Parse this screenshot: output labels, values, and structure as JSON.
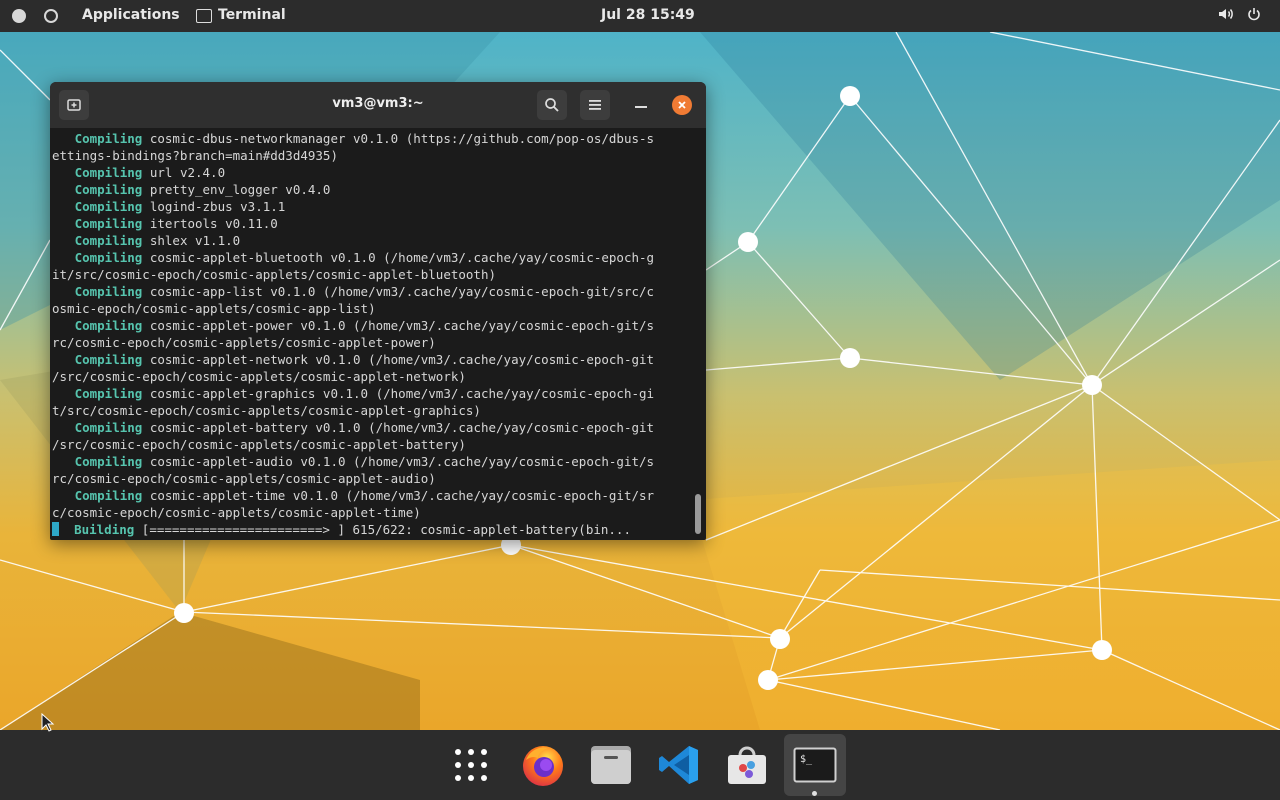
{
  "top_panel": {
    "applications_label": "Applications",
    "terminal_label": "Terminal",
    "datetime": "Jul 28  15:49",
    "volume_icon": "volume-icon",
    "power_icon": "power-icon"
  },
  "terminal": {
    "title": "vm3@vm3:~",
    "lines": [
      {
        "kw": "   Compiling",
        "text": " cosmic-dbus-networkmanager v0.1.0 (https://github.com/pop-os/dbus-s"
      },
      {
        "kw": "",
        "text": "ettings-bindings?branch=main#dd3d4935)"
      },
      {
        "kw": "   Compiling",
        "text": " url v2.4.0"
      },
      {
        "kw": "   Compiling",
        "text": " pretty_env_logger v0.4.0"
      },
      {
        "kw": "   Compiling",
        "text": " logind-zbus v3.1.1"
      },
      {
        "kw": "   Compiling",
        "text": " itertools v0.11.0"
      },
      {
        "kw": "   Compiling",
        "text": " shlex v1.1.0"
      },
      {
        "kw": "   Compiling",
        "text": " cosmic-applet-bluetooth v0.1.0 (/home/vm3/.cache/yay/cosmic-epoch-g"
      },
      {
        "kw": "",
        "text": "it/src/cosmic-epoch/cosmic-applets/cosmic-applet-bluetooth)"
      },
      {
        "kw": "   Compiling",
        "text": " cosmic-app-list v0.1.0 (/home/vm3/.cache/yay/cosmic-epoch-git/src/c"
      },
      {
        "kw": "",
        "text": "osmic-epoch/cosmic-applets/cosmic-app-list)"
      },
      {
        "kw": "   Compiling",
        "text": " cosmic-applet-power v0.1.0 (/home/vm3/.cache/yay/cosmic-epoch-git/s"
      },
      {
        "kw": "",
        "text": "rc/cosmic-epoch/cosmic-applets/cosmic-applet-power)"
      },
      {
        "kw": "   Compiling",
        "text": " cosmic-applet-network v0.1.0 (/home/vm3/.cache/yay/cosmic-epoch-git"
      },
      {
        "kw": "",
        "text": "/src/cosmic-epoch/cosmic-applets/cosmic-applet-network)"
      },
      {
        "kw": "   Compiling",
        "text": " cosmic-applet-graphics v0.1.0 (/home/vm3/.cache/yay/cosmic-epoch-gi"
      },
      {
        "kw": "",
        "text": "t/src/cosmic-epoch/cosmic-applets/cosmic-applet-graphics)"
      },
      {
        "kw": "   Compiling",
        "text": " cosmic-applet-battery v0.1.0 (/home/vm3/.cache/yay/cosmic-epoch-git"
      },
      {
        "kw": "",
        "text": "/src/cosmic-epoch/cosmic-applets/cosmic-applet-battery)"
      },
      {
        "kw": "   Compiling",
        "text": " cosmic-applet-audio v0.1.0 (/home/vm3/.cache/yay/cosmic-epoch-git/s"
      },
      {
        "kw": "",
        "text": "rc/cosmic-epoch/cosmic-applets/cosmic-applet-audio)"
      },
      {
        "kw": "   Compiling",
        "text": " cosmic-applet-time v0.1.0 (/home/vm3/.cache/yay/cosmic-epoch-git/sr"
      },
      {
        "kw": "",
        "text": "c/cosmic-epoch/cosmic-applets/cosmic-applet-time)"
      }
    ],
    "building_label": "Building",
    "building_text": " [=======================> ] 615/622: cosmic-applet-battery(bin..."
  },
  "dock": {
    "items": [
      "app-grid-icon",
      "firefox-icon",
      "files-icon",
      "vscode-icon",
      "store-icon",
      "terminal-icon"
    ]
  },
  "colors": {
    "accent": "#f07b34",
    "terminal_keyword": "#56c4ae",
    "panel": "#2c2c2c"
  }
}
